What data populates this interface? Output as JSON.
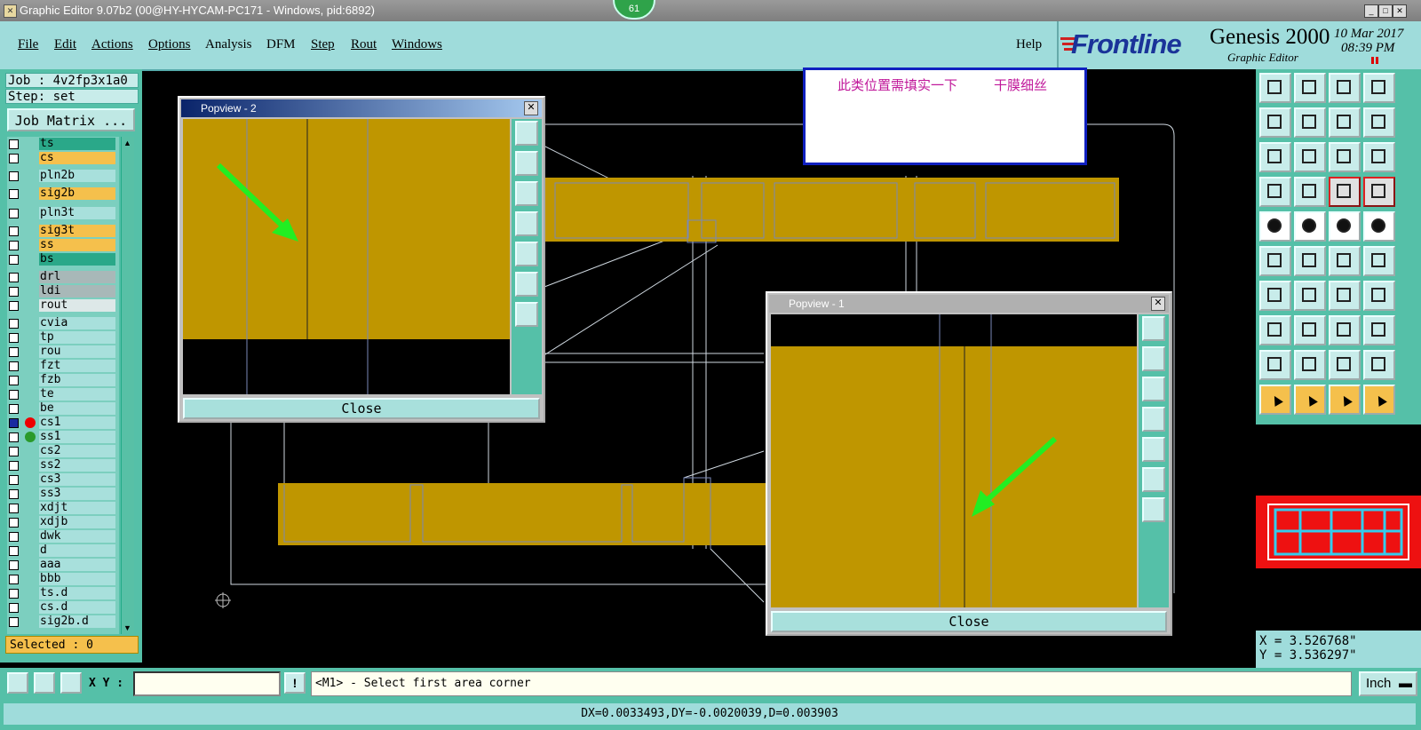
{
  "window": {
    "title": "Graphic Editor 9.07b2 (00@HY-HYCAM-PC171 - Windows, pid:6892)",
    "badge": "61"
  },
  "menu": {
    "items": [
      "File",
      "Edit",
      "Actions",
      "Options",
      "Analysis",
      "DFM",
      "Step",
      "Rout",
      "Windows"
    ],
    "help": "Help"
  },
  "brand": {
    "logo": "Frontline",
    "product": "Genesis 2000",
    "subtitle": "Graphic Editor",
    "date": "10 Mar 2017",
    "time": "08:39 PM"
  },
  "job": {
    "job_label": "Job : 4v2fp3x1a0",
    "step_label": "Step: set",
    "matrix_button": "Job Matrix ..."
  },
  "layers": [
    {
      "name": "ts",
      "color": "#2aa889"
    },
    {
      "name": "cs",
      "color": "#f5c04c"
    },
    {
      "name": "pln2b",
      "color": "#a8e0dc"
    },
    {
      "name": "sig2b",
      "color": "#f5c04c"
    },
    {
      "name": "pln3t",
      "color": "#a8e0dc"
    },
    {
      "name": "sig3t",
      "color": "#f5c04c"
    },
    {
      "name": "ss",
      "color": "#f5c04c"
    },
    {
      "name": "bs",
      "color": "#2aa889"
    },
    {
      "name": "drl",
      "color": "#a8b8b8"
    },
    {
      "name": "ldi",
      "color": "#a8b8b8"
    },
    {
      "name": "rout",
      "color": "#dde8e8"
    },
    {
      "name": "cvia",
      "color": "#a8e0dc"
    },
    {
      "name": "tp",
      "color": "#a8e0dc"
    },
    {
      "name": "rou",
      "color": "#a8e0dc"
    },
    {
      "name": "fzt",
      "color": "#a8e0dc"
    },
    {
      "name": "fzb",
      "color": "#a8e0dc"
    },
    {
      "name": "te",
      "color": "#a8e0dc"
    },
    {
      "name": "be",
      "color": "#a8e0dc"
    },
    {
      "name": "cs1",
      "color": "#a8e0dc"
    },
    {
      "name": "ss1",
      "color": "#a8e0dc"
    },
    {
      "name": "cs2",
      "color": "#a8e0dc"
    },
    {
      "name": "ss2",
      "color": "#a8e0dc"
    },
    {
      "name": "cs3",
      "color": "#a8e0dc"
    },
    {
      "name": "ss3",
      "color": "#a8e0dc"
    },
    {
      "name": "xdjt",
      "color": "#a8e0dc"
    },
    {
      "name": "xdjb",
      "color": "#a8e0dc"
    },
    {
      "name": "dwk",
      "color": "#a8e0dc"
    },
    {
      "name": "d",
      "color": "#a8e0dc"
    },
    {
      "name": "aaa",
      "color": "#a8e0dc"
    },
    {
      "name": "bbb",
      "color": "#a8e0dc"
    },
    {
      "name": "ts.d",
      "color": "#a8e0dc"
    },
    {
      "name": "cs.d",
      "color": "#a8e0dc"
    },
    {
      "name": "sig2b.d",
      "color": "#a8e0dc"
    }
  ],
  "selected": "Selected : 0",
  "note": {
    "text1": "此类位置需填实一下",
    "text2": "干膜细丝"
  },
  "popview2": {
    "title": "Popview - 2",
    "close": "Close"
  },
  "popview1": {
    "title": "Popview - 1",
    "close": "Close"
  },
  "coords": {
    "x": "X = 3.526768\"",
    "y": "Y = 3.536297\""
  },
  "cmd": {
    "xy_label": "X Y :",
    "xy_value": "",
    "prompt": "<M1> - Select first area corner",
    "unit": "Inch"
  },
  "status": "DX=0.0033493,DY=-0.0020039,D=0.003903",
  "colors": {
    "copper": "#bf9600",
    "panel": "#55c0a8",
    "light": "#9fdcdb",
    "arrow": "#22ee22"
  }
}
